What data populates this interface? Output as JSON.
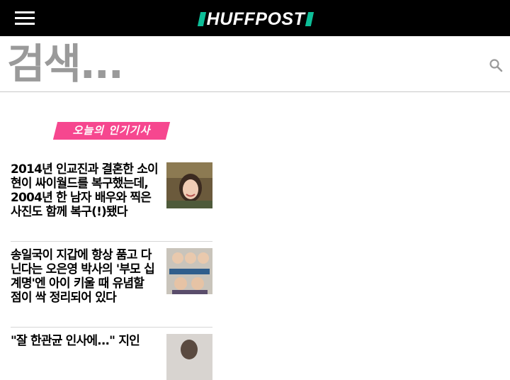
{
  "header": {
    "menu_icon": "hamburger-menu-icon",
    "logo_text": "HUFFPOST",
    "logo_accent_color": "#0dbe98"
  },
  "search": {
    "placeholder": "검색...",
    "icon": "search-icon"
  },
  "popular": {
    "heading": "오늘의 인기기사",
    "heading_color": "#f6478f",
    "articles": [
      {
        "headline": "2014년 인교진과 결혼한 소이현이 싸이월드를 복구했는데, 2004년 한 남자 배우와 찍은 사진도 함께 복구(!)됐다",
        "thumbnail": "smiling-woman-photo"
      },
      {
        "headline": "송일국이 지갑에 항상 품고 다닌다는 오은영 박사의 '부모 십계명'엔 아이 키울 때 유념할 점이 싹 정리되어 있다",
        "thumbnail": "triplets-tv-show-photo"
      },
      {
        "headline": "\"잘 한관균 인사에...\" 지인",
        "thumbnail": "portrait-photo"
      }
    ]
  }
}
